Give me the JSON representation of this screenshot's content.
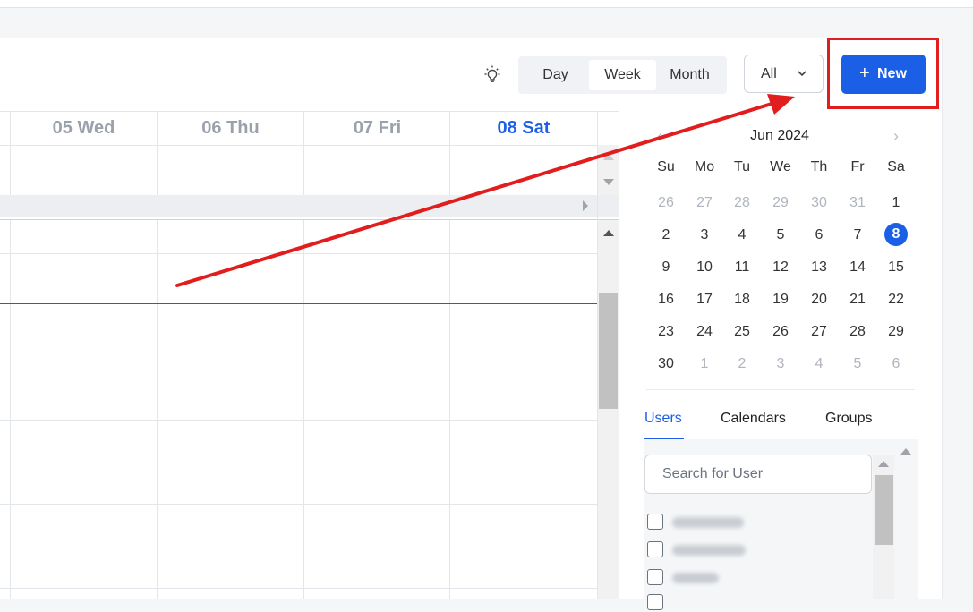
{
  "toolbar": {
    "hint_icon": "lightbulb-icon",
    "views": [
      "Day",
      "Week",
      "Month"
    ],
    "active_view": "Week",
    "filter_value": "All",
    "new_button_label": "New",
    "new_button_icon": "plus-icon"
  },
  "week": {
    "days": [
      "05 Wed",
      "06 Thu",
      "07 Fri",
      "08 Sat"
    ],
    "today": "08 Sat"
  },
  "mini_calendar": {
    "month_label": "Jun 2024",
    "weekdays": [
      "Su",
      "Mo",
      "Tu",
      "We",
      "Th",
      "Fr",
      "Sa"
    ],
    "weeks": [
      [
        "26",
        "27",
        "28",
        "29",
        "30",
        "31",
        "1"
      ],
      [
        "2",
        "3",
        "4",
        "5",
        "6",
        "7",
        "8"
      ],
      [
        "9",
        "10",
        "11",
        "12",
        "13",
        "14",
        "15"
      ],
      [
        "16",
        "17",
        "18",
        "19",
        "20",
        "21",
        "22"
      ],
      [
        "23",
        "24",
        "25",
        "26",
        "27",
        "28",
        "29"
      ],
      [
        "30",
        "1",
        "2",
        "3",
        "4",
        "5",
        "6"
      ]
    ],
    "selected": "8"
  },
  "sidebar": {
    "tabs": [
      "Users",
      "Calendars",
      "Groups"
    ],
    "active_tab": "Users",
    "search_placeholder": "Search for User"
  },
  "colors": {
    "accent": "#1a5fe6",
    "annotation": "#e11d1d",
    "now_line": "#e02020"
  }
}
